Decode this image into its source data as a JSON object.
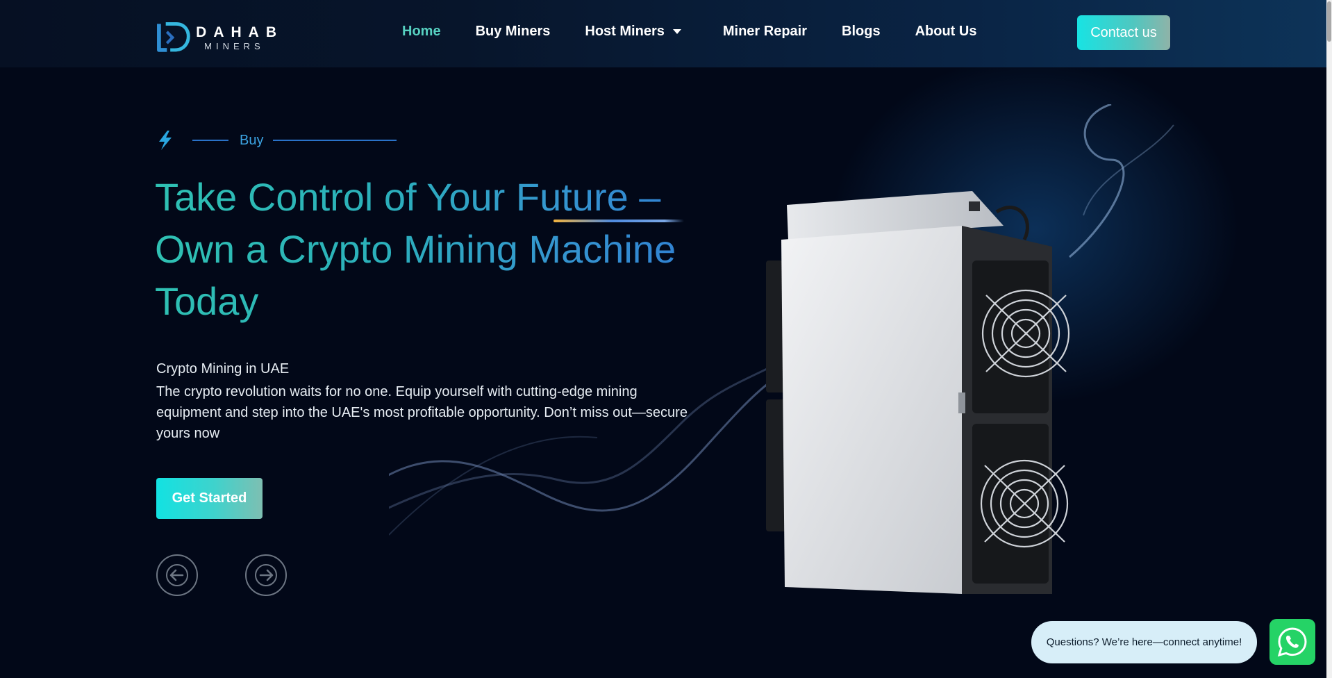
{
  "header": {
    "logo": {
      "word": "DAHAB",
      "sub": "MINERS"
    },
    "nav": [
      {
        "label": "Home",
        "active": true
      },
      {
        "label": "Buy Miners",
        "active": false
      },
      {
        "label": "Host Miners",
        "active": false,
        "has_dropdown": true
      },
      {
        "label": "Miner Repair",
        "active": false
      },
      {
        "label": "Blogs",
        "active": false
      },
      {
        "label": "About Us",
        "active": false
      }
    ],
    "contact_label": "Contact us"
  },
  "hero": {
    "eyebrow": "Buy",
    "headline": "Take Control of Your Future – Own a Crypto Mining Machine Today",
    "subtitle": "Crypto Mining in UAE",
    "body": "The crypto revolution waits for no one. Equip yourself with cutting-edge mining equipment and step into the UAE's most profitable opportunity. Don’t miss out—secure yours now",
    "cta_label": "Get Started",
    "prev_icon": "arrow-left-icon",
    "next_icon": "arrow-right-icon"
  },
  "chat": {
    "bubble_text": "Questions? We’re here—connect anytime!",
    "icon": "whatsapp-icon"
  },
  "colors": {
    "accent_teal": "#18e3e3",
    "nav_active": "#57d1c1",
    "background": "#020818",
    "whatsapp": "#25d366"
  }
}
